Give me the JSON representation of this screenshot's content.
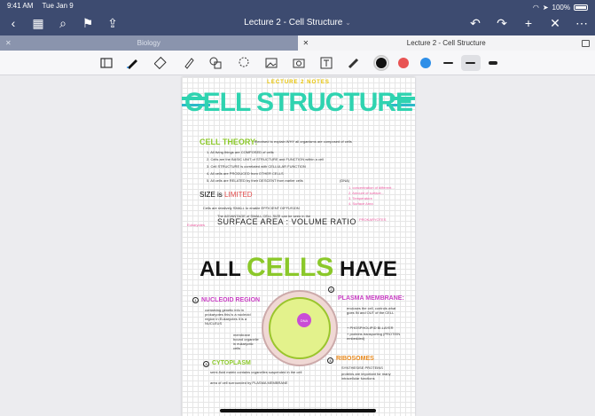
{
  "status": {
    "time": "9:41 AM",
    "date": "Tue Jan 9",
    "battery": "100%"
  },
  "nav": {
    "title": "Lecture 2 - Cell Structure",
    "title_chevron": "⌄"
  },
  "tabs": [
    {
      "label": "Biology",
      "active": false
    },
    {
      "label": "Lecture 2 - Cell Structure",
      "active": true
    }
  ],
  "colors": {
    "black": "#111111",
    "red": "#e85454",
    "blue": "#2f8fe8",
    "teal": "#2fd3b0",
    "green": "#8bc82a",
    "magenta": "#c93fc4",
    "orange": "#e98a1c"
  },
  "note": {
    "lecture": "LECTURE 2 NOTES",
    "title": "CELL STRUCTURE",
    "cell_theory_heading": "CELL THEORY:",
    "cell_theory_note": "theorised to explain WHY all organisms are composed of cells",
    "theory_points": [
      "1. All living things are COMPOSED of cells",
      "2. Cells are the BASIC UNIT of STRUCTURE and FUNCTION within a cell",
      "3. Cell STRUCTURE is correlated with CELLULAR FUNCTION",
      "4. All cells are PRODUCED from OTHER CELLS",
      "5. All cells are RELATED by their DESCENT from earlier cells"
    ],
    "dna_tag": "(DNA)",
    "size_heading": "SIZE is",
    "size_limited": "LIMITED",
    "size_line": "Cells are relatively SMALL to enable EFFICIENT DIFFUSION",
    "advantage_line": "The ADVANTAGE of SMALL CELL SIZE can be seen in the",
    "surface_area": "SURFACE AREA : VOLUME RATIO",
    "diffusion_notes": [
      "1. concentration of different...",
      "2. Amount of surface...",
      "3. Temperature",
      "4. Surface Area"
    ],
    "prokaryotes_tag": "PROKARYOTES",
    "eukaryotes_tag": "Eukaryotes",
    "all_cells": {
      "a": "ALL",
      "b": "CELLS",
      "c": "HAVE"
    },
    "labels": {
      "nucleoid": "NUCLEOID REGION",
      "plasma": "PLASMA MEMBRANE:",
      "cytoplasm": "CYTOPLASM",
      "ribosomes": "RIBOSOMES"
    },
    "dna": "DNA",
    "nucleoid_text": "containing genetic info in prokaryotes this is a nucleoid region In Eukaryotes it is a NUCLEUS",
    "nucleoid_side": "membrane bound organelle in eukaryotic cells",
    "plasma_text": "encloses the cell, controls what goes IN and OUT of the CELL",
    "plasma_extra": "+ PHOSPHOLIPID BI-LAYER",
    "plasma_extra2": "+ proteins transporting (PROTEIN embedded)",
    "cytoplasm_text": "semi-fluid matrix contains organelles suspended in the cell",
    "cytoplasm_text2": "area of cell surrounded by PLASMA MEMBRANE",
    "ribosomes_text": "SYNTHESISE PROTEINS",
    "ribosomes_text2": "proteins are important for many intracellular functions",
    "numbers": [
      "1",
      "2",
      "3",
      "4"
    ]
  }
}
